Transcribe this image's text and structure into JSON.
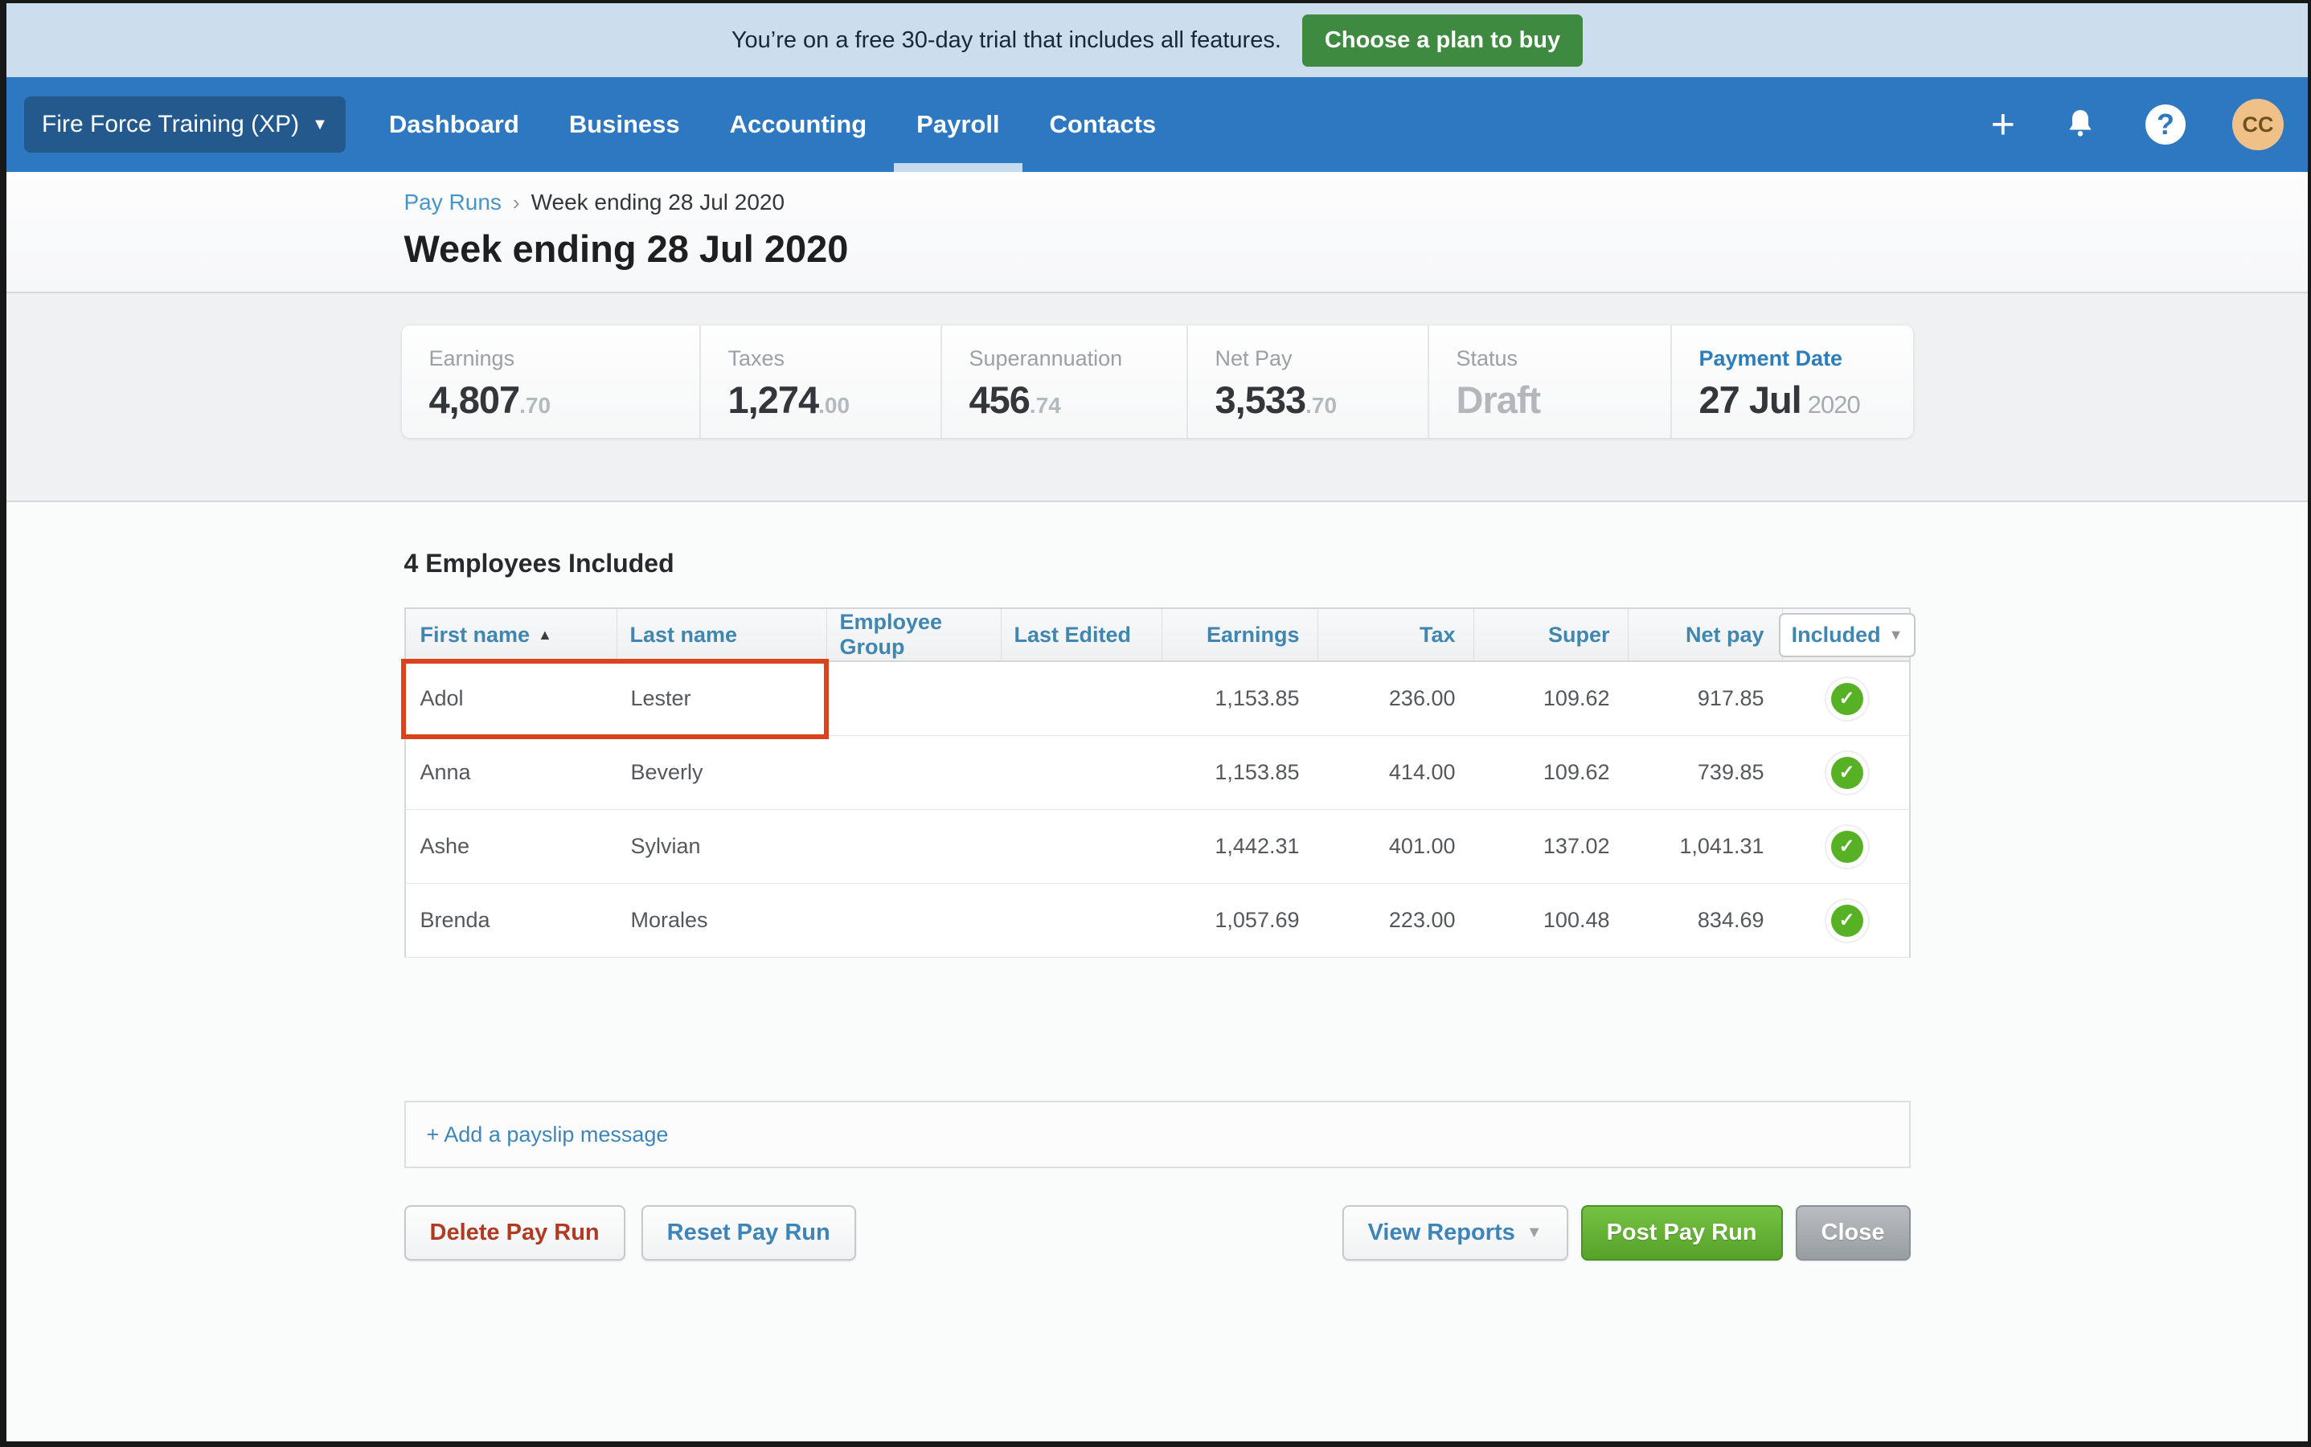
{
  "trial_banner": {
    "message": "You’re on a free 30-day trial that includes all features.",
    "cta_label": "Choose a plan to buy"
  },
  "navbar": {
    "org_name": "Fire Force Training (XP)",
    "items": [
      {
        "label": "Dashboard",
        "active": false
      },
      {
        "label": "Business",
        "active": false
      },
      {
        "label": "Accounting",
        "active": false
      },
      {
        "label": "Payroll",
        "active": true
      },
      {
        "label": "Contacts",
        "active": false
      }
    ],
    "avatar_initials": "CC"
  },
  "breadcrumb": {
    "parent": "Pay Runs",
    "current": "Week ending 28 Jul 2020"
  },
  "page_title": "Week ending 28 Jul 2020",
  "summary": {
    "cards": [
      {
        "label": "Earnings",
        "main": "4,807",
        "fraction": ".70"
      },
      {
        "label": "Taxes",
        "main": "1,274",
        "fraction": ".00"
      },
      {
        "label": "Superannuation",
        "main": "456",
        "fraction": ".74"
      },
      {
        "label": "Net Pay",
        "main": "3,533",
        "fraction": ".70"
      },
      {
        "label": "Status",
        "value": "Draft"
      },
      {
        "label": "Payment Date",
        "main": "27 Jul",
        "year": "2020"
      }
    ]
  },
  "employees": {
    "heading": "4 Employees Included",
    "columns": [
      "First name",
      "Last name",
      "Employee Group",
      "Last Edited",
      "Earnings",
      "Tax",
      "Super",
      "Net pay"
    ],
    "included_filter_label": "Included",
    "rows": [
      {
        "first": "Adol",
        "last": "Lester",
        "group": "",
        "last_edited": "",
        "earnings": "1,153.85",
        "tax": "236.00",
        "super": "109.62",
        "net": "917.85",
        "included": true,
        "highlighted": true
      },
      {
        "first": "Anna",
        "last": "Beverly",
        "group": "",
        "last_edited": "",
        "earnings": "1,153.85",
        "tax": "414.00",
        "super": "109.62",
        "net": "739.85",
        "included": true,
        "highlighted": false
      },
      {
        "first": "Ashe",
        "last": "Sylvian",
        "group": "",
        "last_edited": "",
        "earnings": "1,442.31",
        "tax": "401.00",
        "super": "137.02",
        "net": "1,041.31",
        "included": true,
        "highlighted": false
      },
      {
        "first": "Brenda",
        "last": "Morales",
        "group": "",
        "last_edited": "",
        "earnings": "1,057.69",
        "tax": "223.00",
        "super": "100.48",
        "net": "834.69",
        "included": true,
        "highlighted": false
      }
    ]
  },
  "payslip": {
    "add_label": "+ Add a payslip message"
  },
  "actions": {
    "delete_label": "Delete Pay Run",
    "reset_label": "Reset Pay Run",
    "view_reports_label": "View Reports",
    "post_label": "Post Pay Run",
    "close_label": "Close"
  },
  "icons": {
    "plus": "+",
    "help": "?",
    "caret_down": "▼",
    "org_caret": "▼",
    "sort_asc": "▲",
    "breadcrumb_sep": "›",
    "check": "✓"
  },
  "colors": {
    "banner_bg": "#ccddee",
    "nav_bg": "#2e78c2",
    "org_btn_bg": "#24598e",
    "active_tab_underline": "#c5daee",
    "cta_green": "#3e8a41",
    "post_green": "#57a22a",
    "close_gray": "#989da1",
    "delete_red": "#b03a22",
    "link_blue": "#3e86b8",
    "table_header_blue": "#3f86b0",
    "highlight_red": "#d9441c",
    "check_green": "#56b224",
    "avatar_bg": "#efc189",
    "status_gray": "#b3b7bb"
  }
}
